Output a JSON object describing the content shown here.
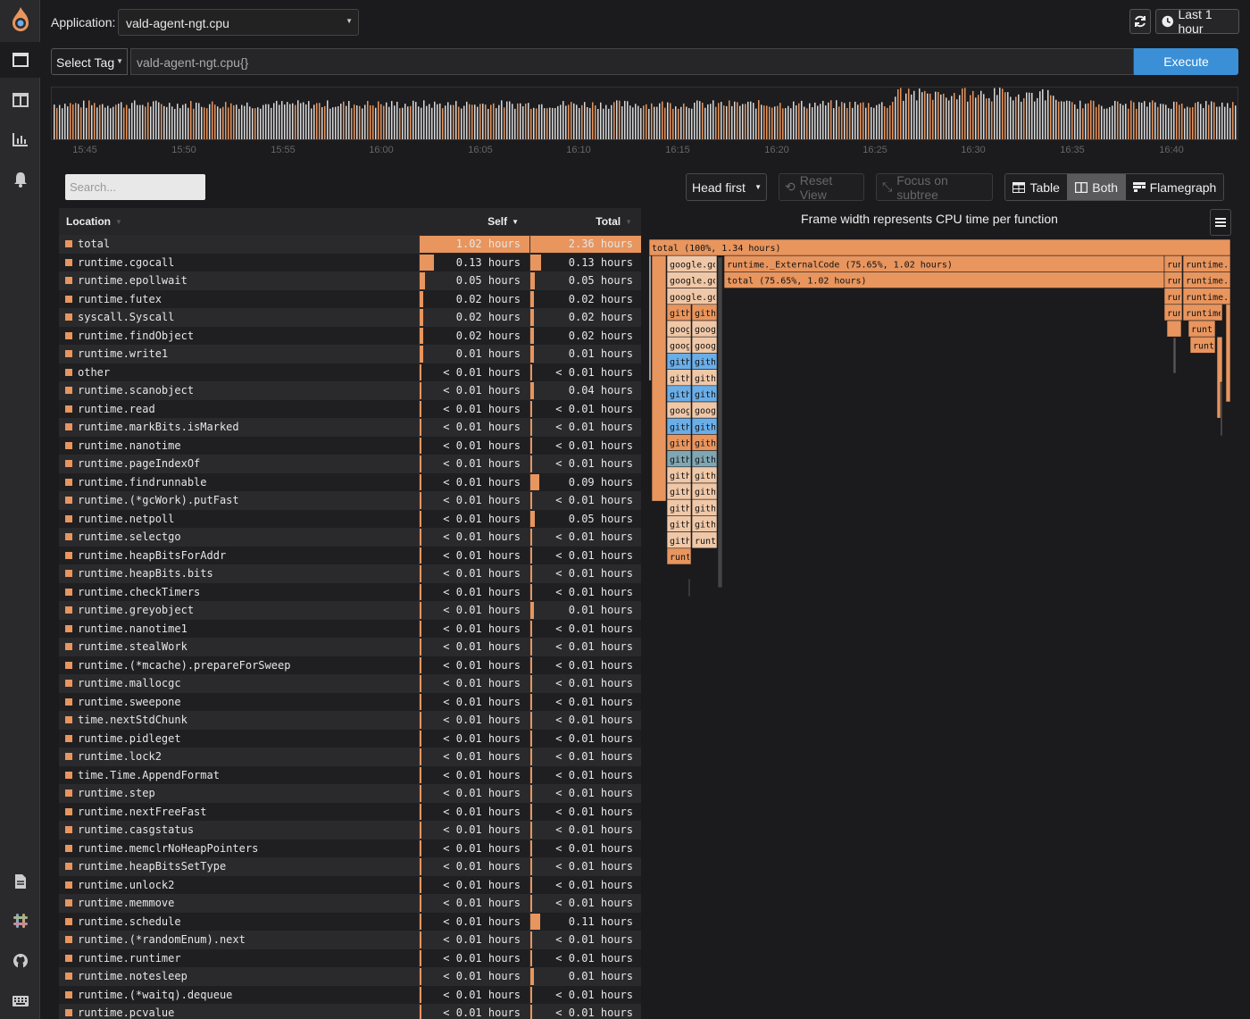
{
  "topbar": {
    "application_label": "Application:",
    "application_value": "vald-agent-ngt.cpu",
    "time_range_label": "Last 1 hour"
  },
  "query": {
    "tag_select_label": "Select Tag",
    "query_text": "vald-agent-ngt.cpu{}",
    "execute_label": "Execute"
  },
  "timeline": {
    "labels": [
      "15:45",
      "15:50",
      "15:55",
      "16:00",
      "16:05",
      "16:10",
      "16:15",
      "16:20",
      "16:25",
      "16:30",
      "16:35",
      "16:40"
    ]
  },
  "toolbar": {
    "search_placeholder": "Search...",
    "sort_mode": "Head first",
    "reset_view": "Reset View",
    "focus_subtree": "Focus on subtree",
    "view_table": "Table",
    "view_both": "Both",
    "view_flamegraph": "Flamegraph"
  },
  "table": {
    "headers": {
      "location": "Location",
      "self": "Self",
      "total": "Total"
    },
    "rows": [
      {
        "name": "total",
        "self": "1.02 hours",
        "total": "2.36 hours",
        "self_frac": 1.0,
        "total_frac": 1.0
      },
      {
        "name": "runtime.cgocall",
        "self": "0.13 hours",
        "total": "0.13 hours",
        "self_frac": 0.13,
        "total_frac": 0.1
      },
      {
        "name": "runtime.epollwait",
        "self": "0.05 hours",
        "total": "0.05 hours",
        "self_frac": 0.05,
        "total_frac": 0.04
      },
      {
        "name": "runtime.futex",
        "self": "0.02 hours",
        "total": "0.02 hours",
        "self_frac": 0.02,
        "total_frac": 0.02
      },
      {
        "name": "syscall.Syscall",
        "self": "0.02 hours",
        "total": "0.02 hours",
        "self_frac": 0.02,
        "total_frac": 0.02
      },
      {
        "name": "runtime.findObject",
        "self": "0.02 hours",
        "total": "0.02 hours",
        "self_frac": 0.02,
        "total_frac": 0.02
      },
      {
        "name": "runtime.write1",
        "self": "0.01 hours",
        "total": "0.01 hours",
        "self_frac": 0.01,
        "total_frac": 0.01
      },
      {
        "name": "other",
        "self": "< 0.01 hours",
        "total": "< 0.01 hours",
        "self_frac": 0.0,
        "total_frac": 0.0
      },
      {
        "name": "runtime.scanobject",
        "self": "< 0.01 hours",
        "total": "0.04 hours",
        "self_frac": 0.0,
        "total_frac": 0.03
      },
      {
        "name": "runtime.read",
        "self": "< 0.01 hours",
        "total": "< 0.01 hours",
        "self_frac": 0.0,
        "total_frac": 0.0
      },
      {
        "name": "runtime.markBits.isMarked",
        "self": "< 0.01 hours",
        "total": "< 0.01 hours",
        "self_frac": 0.0,
        "total_frac": 0.0
      },
      {
        "name": "runtime.nanotime",
        "self": "< 0.01 hours",
        "total": "< 0.01 hours",
        "self_frac": 0.0,
        "total_frac": 0.0
      },
      {
        "name": "runtime.pageIndexOf",
        "self": "< 0.01 hours",
        "total": "< 0.01 hours",
        "self_frac": 0.0,
        "total_frac": 0.0
      },
      {
        "name": "runtime.findrunnable",
        "self": "< 0.01 hours",
        "total": "0.09 hours",
        "self_frac": 0.0,
        "total_frac": 0.08
      },
      {
        "name": "runtime.(*gcWork).putFast",
        "self": "< 0.01 hours",
        "total": "< 0.01 hours",
        "self_frac": 0.0,
        "total_frac": 0.0
      },
      {
        "name": "runtime.netpoll",
        "self": "< 0.01 hours",
        "total": "0.05 hours",
        "self_frac": 0.0,
        "total_frac": 0.04
      },
      {
        "name": "runtime.selectgo",
        "self": "< 0.01 hours",
        "total": "< 0.01 hours",
        "self_frac": 0.0,
        "total_frac": 0.0
      },
      {
        "name": "runtime.heapBitsForAddr",
        "self": "< 0.01 hours",
        "total": "< 0.01 hours",
        "self_frac": 0.0,
        "total_frac": 0.0
      },
      {
        "name": "runtime.heapBits.bits",
        "self": "< 0.01 hours",
        "total": "< 0.01 hours",
        "self_frac": 0.0,
        "total_frac": 0.0
      },
      {
        "name": "runtime.checkTimers",
        "self": "< 0.01 hours",
        "total": "< 0.01 hours",
        "self_frac": 0.0,
        "total_frac": 0.0
      },
      {
        "name": "runtime.greyobject",
        "self": "< 0.01 hours",
        "total": "0.01 hours",
        "self_frac": 0.0,
        "total_frac": 0.01
      },
      {
        "name": "runtime.nanotime1",
        "self": "< 0.01 hours",
        "total": "< 0.01 hours",
        "self_frac": 0.0,
        "total_frac": 0.0
      },
      {
        "name": "runtime.stealWork",
        "self": "< 0.01 hours",
        "total": "< 0.01 hours",
        "self_frac": 0.0,
        "total_frac": 0.0
      },
      {
        "name": "runtime.(*mcache).prepareForSweep",
        "self": "< 0.01 hours",
        "total": "< 0.01 hours",
        "self_frac": 0.0,
        "total_frac": 0.0
      },
      {
        "name": "runtime.mallocgc",
        "self": "< 0.01 hours",
        "total": "< 0.01 hours",
        "self_frac": 0.0,
        "total_frac": 0.0
      },
      {
        "name": "runtime.sweepone",
        "self": "< 0.01 hours",
        "total": "< 0.01 hours",
        "self_frac": 0.0,
        "total_frac": 0.0
      },
      {
        "name": "time.nextStdChunk",
        "self": "< 0.01 hours",
        "total": "< 0.01 hours",
        "self_frac": 0.0,
        "total_frac": 0.0
      },
      {
        "name": "runtime.pidleget",
        "self": "< 0.01 hours",
        "total": "< 0.01 hours",
        "self_frac": 0.0,
        "total_frac": 0.0
      },
      {
        "name": "runtime.lock2",
        "self": "< 0.01 hours",
        "total": "< 0.01 hours",
        "self_frac": 0.0,
        "total_frac": 0.0
      },
      {
        "name": "time.Time.AppendFormat",
        "self": "< 0.01 hours",
        "total": "< 0.01 hours",
        "self_frac": 0.0,
        "total_frac": 0.0
      },
      {
        "name": "runtime.step",
        "self": "< 0.01 hours",
        "total": "< 0.01 hours",
        "self_frac": 0.0,
        "total_frac": 0.0
      },
      {
        "name": "runtime.nextFreeFast",
        "self": "< 0.01 hours",
        "total": "< 0.01 hours",
        "self_frac": 0.0,
        "total_frac": 0.0
      },
      {
        "name": "runtime.casgstatus",
        "self": "< 0.01 hours",
        "total": "< 0.01 hours",
        "self_frac": 0.0,
        "total_frac": 0.0
      },
      {
        "name": "runtime.memclrNoHeapPointers",
        "self": "< 0.01 hours",
        "total": "< 0.01 hours",
        "self_frac": 0.0,
        "total_frac": 0.0
      },
      {
        "name": "runtime.heapBitsSetType",
        "self": "< 0.01 hours",
        "total": "< 0.01 hours",
        "self_frac": 0.0,
        "total_frac": 0.0
      },
      {
        "name": "runtime.unlock2",
        "self": "< 0.01 hours",
        "total": "< 0.01 hours",
        "self_frac": 0.0,
        "total_frac": 0.0
      },
      {
        "name": "runtime.memmove",
        "self": "< 0.01 hours",
        "total": "< 0.01 hours",
        "self_frac": 0.0,
        "total_frac": 0.0
      },
      {
        "name": "runtime.schedule",
        "self": "< 0.01 hours",
        "total": "0.11 hours",
        "self_frac": 0.0,
        "total_frac": 0.09
      },
      {
        "name": "runtime.(*randomEnum).next",
        "self": "< 0.01 hours",
        "total": "< 0.01 hours",
        "self_frac": 0.0,
        "total_frac": 0.0
      },
      {
        "name": "runtime.runtimer",
        "self": "< 0.01 hours",
        "total": "< 0.01 hours",
        "self_frac": 0.0,
        "total_frac": 0.0
      },
      {
        "name": "runtime.notesleep",
        "self": "< 0.01 hours",
        "total": "0.01 hours",
        "self_frac": 0.0,
        "total_frac": 0.01
      },
      {
        "name": "runtime.(*waitq).dequeue",
        "self": "< 0.01 hours",
        "total": "< 0.01 hours",
        "self_frac": 0.0,
        "total_frac": 0.0
      },
      {
        "name": "runtime.pcvalue",
        "self": "< 0.01 hours",
        "total": "< 0.01 hours",
        "self_frac": 0.0,
        "total_frac": 0.0
      }
    ]
  },
  "flamegraph": {
    "title": "Frame width represents CPU time per function",
    "root_label": "total (100%, 1.34 hours)",
    "external_label": "runtime._ExternalCode (75.65%, 1.02 hours)",
    "external_child_label": "total (75.65%, 1.02 hours)",
    "colors": {
      "orange": "#e8955e",
      "light": "#f0c8a8",
      "blue": "#6aaee8",
      "grey": "#d6d6d6",
      "teal": "#7fa6b3"
    }
  }
}
